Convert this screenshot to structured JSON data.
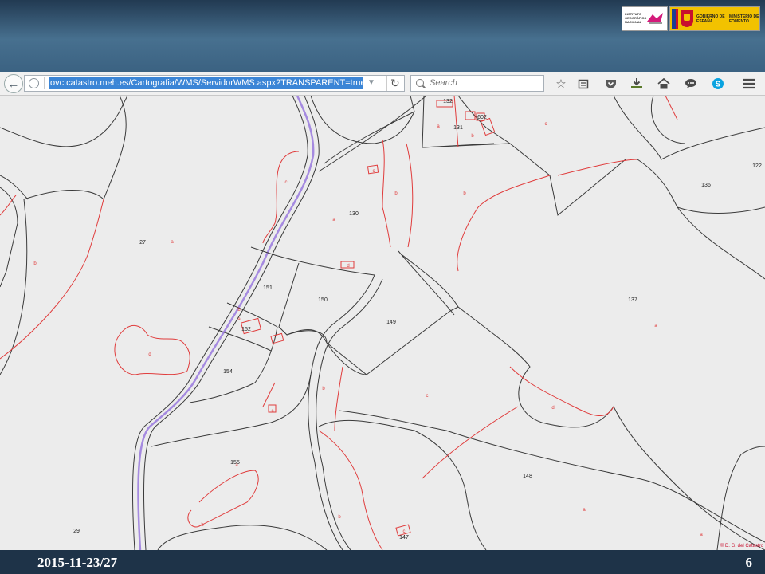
{
  "header": {
    "logo_ign_text": "INSTITUTO GEOGRÁFICO NACIONAL",
    "logo_gov_text_1": "GOBIERNO DE ESPAÑA",
    "logo_gov_text_2": "MINISTERIO DE FOMENTO"
  },
  "browser": {
    "url": "ovc.catastro.meh.es/Cartografia/WMS/ServidorWMS.aspx?TRANSPARENT=true",
    "search_placeholder": "Search"
  },
  "map": {
    "parcel_labels": [
      "132",
      "131",
      "602",
      "122",
      "136",
      "130",
      "27",
      "151",
      "150",
      "149",
      "137",
      "152",
      "154",
      "155",
      "148",
      "29",
      "147"
    ],
    "subparcel_letters": [
      "a",
      "b",
      "c",
      "d"
    ],
    "credit": "© D. G. del Catastro",
    "colors": {
      "background": "#ececec",
      "parcel_border": "#3a3a3a",
      "subparcel_border": "#e03c3c",
      "road_line": "#a58ae0"
    }
  },
  "footer": {
    "date": "2015-11-23/27",
    "page_number": "6"
  }
}
